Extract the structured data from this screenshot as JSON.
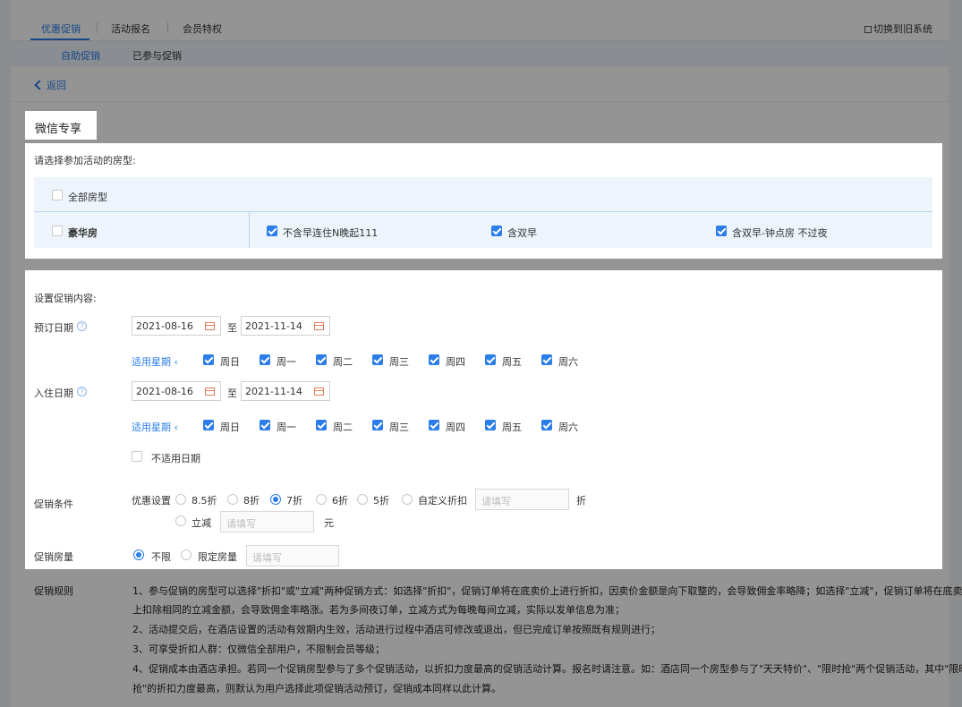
{
  "topnav": {
    "tabs": [
      "优惠促销",
      "活动报名",
      "会员特权"
    ],
    "switch_label": "切换到旧系统"
  },
  "subnav": {
    "tabs": [
      "自助促销",
      "已参与促销"
    ]
  },
  "back_label": "返回",
  "promo_title": "微信专享",
  "room_section": {
    "label": "请选择参加活动的房型:",
    "all_rooms": "全部房型",
    "room_name": "豪华房",
    "rates": [
      {
        "label": "不含早连住N晚起111",
        "checked": true
      },
      {
        "label": "含双早",
        "checked": true
      },
      {
        "label": "含双早-钟点房 不过夜",
        "checked": true
      }
    ]
  },
  "content": {
    "label": "设置促销内容:",
    "booking_date_label": "预订日期",
    "checkin_date_label": "入住日期",
    "booking_start": "2021-08-16",
    "booking_end": "2021-11-14",
    "checkin_start": "2021-08-16",
    "checkin_end": "2021-11-14",
    "to": "至",
    "weekday_label": "适用星期",
    "weekdays": [
      "周日",
      "周一",
      "周二",
      "周三",
      "周四",
      "周五",
      "周六"
    ],
    "exclude_dates": "不适用日期",
    "condition_label": "促销条件",
    "discount_setting": "优惠设置",
    "discount_options": [
      "8.5折",
      "8折",
      "7折",
      "6折",
      "5折",
      "自定义折扣"
    ],
    "selected_discount": "7折",
    "placeholder": "请填写",
    "zhe": "折",
    "reduce": "立减",
    "yuan": "元",
    "room_qty_label": "促销房量",
    "unlimited": "不限",
    "limited": "限定房量"
  },
  "rules": {
    "label": "促销规则",
    "lines": [
      "1、参与促销的房型可以选择\"折扣\"或\"立减\"两种促销方式：如选择\"折扣\"，促销订单将在底卖价上进行折扣，因卖价金额是向下取整的，会导致佣金率略降；如选择\"立减\"，促销订单将在底卖价",
      "上扣除相同的立减金额，会导致佣金率略涨。若为多间夜订单，立减方式为每晚每间立减，实际以发单信息为准；",
      "2、活动提交后，在酒店设置的活动有效期内生效，活动进行过程中酒店可修改或退出，但已完成订单按照既有规则进行；",
      "3、可享受折扣人群：仅微信全部用户，不限制会员等级；",
      "4、促销成本由酒店承担。若同一个促销房型参与了多个促销活动，以折扣力度最高的促销活动计算。报名时请注意。如：酒店同一个房型参与了\"天天特价\"、\"限时抢\"两个促销活动，其中\"限时",
      "抢\"的折扣力度最高，则默认为用户选择此项促销活动预订，促销成本同样以此计算。"
    ]
  }
}
